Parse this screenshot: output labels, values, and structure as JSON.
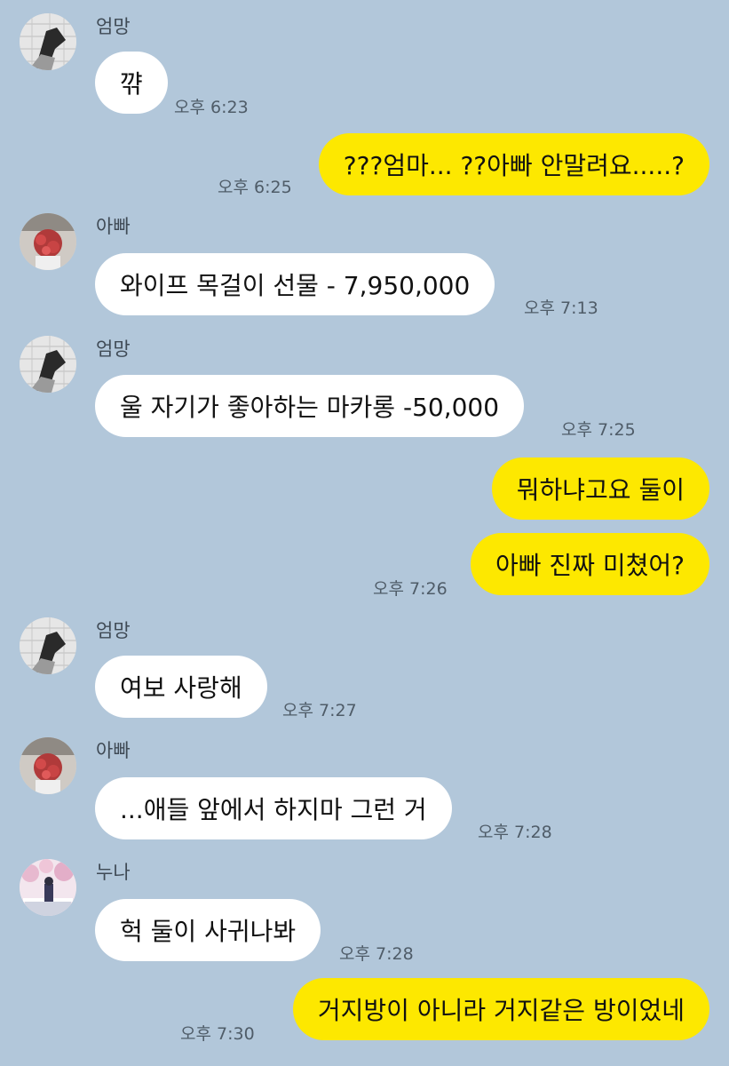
{
  "senders": {
    "mom": "엄망",
    "dad": "아빠",
    "sister": "누나"
  },
  "messages": [
    {
      "text": "꺆",
      "time": "오후 6:23"
    },
    {
      "text": "???엄마... ??아빠 안말려요.....?",
      "time": "오후 6:25"
    },
    {
      "text": "와이프 목걸이 선물 - 7,950,000",
      "time": "오후 7:13"
    },
    {
      "text": "울 자기가 좋아하는 마카롱 -50,000",
      "time": "오후 7:25"
    },
    {
      "text": "뭐하냐고요 둘이"
    },
    {
      "text": "아빠 진짜 미쳤어?",
      "time": "오후 7:26"
    },
    {
      "text": "여보 사랑해",
      "time": "오후 7:27"
    },
    {
      "text": "...애들 앞에서 하지마 그런 거",
      "time": "오후 7:28"
    },
    {
      "text": "헉 둘이 사귀나봐",
      "time": "오후 7:28"
    },
    {
      "text": "거지방이 아니라 거지같은 방이었네",
      "time": "오후 7:30"
    }
  ],
  "colors": {
    "background": "#b2c7da",
    "incoming_bubble": "#ffffff",
    "outgoing_bubble": "#fde800"
  }
}
